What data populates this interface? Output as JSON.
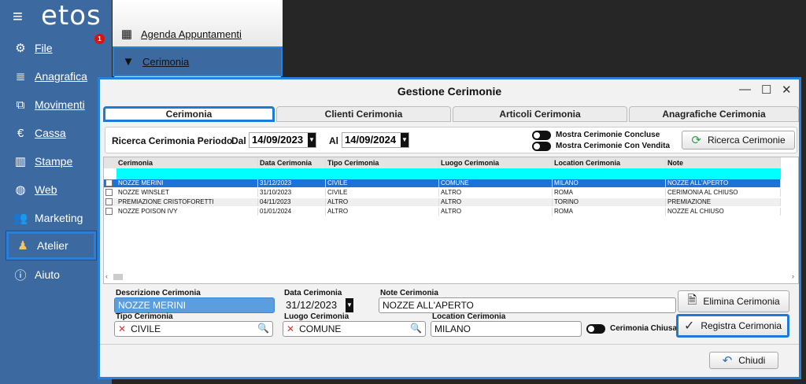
{
  "app": {
    "logo": "etos",
    "badge": "1"
  },
  "sidebar": {
    "items": [
      {
        "label": "File",
        "icon": "gear-icon"
      },
      {
        "label": "Anagrafica",
        "icon": "database-icon"
      },
      {
        "label": "Movimenti",
        "icon": "cubes-icon"
      },
      {
        "label": "Cassa",
        "icon": "euro-icon"
      },
      {
        "label": "Stampe",
        "icon": "bar-chart-icon"
      },
      {
        "label": "Web",
        "icon": "globe-icon"
      },
      {
        "label": "Marketing",
        "icon": "users-icon"
      },
      {
        "label": "Atelier",
        "icon": "child-icon"
      },
      {
        "label": "Aiuto",
        "icon": "info-icon"
      }
    ]
  },
  "submenu": {
    "items": [
      {
        "label": "Agenda Appuntamenti",
        "icon": "calendar-icon"
      },
      {
        "label": "Cerimonia",
        "icon": "tie-icon"
      }
    ]
  },
  "dialog": {
    "title": "Gestione Cerimonie",
    "tabs": [
      "Cerimonia",
      "Clienti Cerimonia",
      "Articoli Cerimonia",
      "Anagrafiche Cerimonia"
    ],
    "search": {
      "period_label": "Ricerca Cerimonia Periodo",
      "from_label": "Dal",
      "from_value": "14/09/2023",
      "to_label": "Al",
      "to_value": "14/09/2024",
      "toggle1": "Mostra Cerimonie Concluse",
      "toggle2": "Mostra Cerimonie Con Vendita",
      "search_button": "Ricerca Cerimonie"
    },
    "grid": {
      "columns": [
        "Cerimonia",
        "Data Cerimonia",
        "Tipo Cerimonia",
        "Luogo Cerimonia",
        "Location Cerimonia",
        "Note"
      ],
      "rows": [
        [
          "NOZZE MERINI",
          "31/12/2023",
          "CIVILE",
          "COMUNE",
          "MILANO",
          "NOZZE ALL'APERTO"
        ],
        [
          "NOZZE WINSLET",
          "31/10/2023",
          "CIVILE",
          "ALTRO",
          "ROMA",
          "CERIMONIA AL CHIUSO"
        ],
        [
          "PREMIAZIONE CRISTOFORETTI",
          "04/11/2023",
          "ALTRO",
          "ALTRO",
          "TORINO",
          "PREMIAZIONE"
        ],
        [
          "NOZZE POISON IVY",
          "01/01/2024",
          "ALTRO",
          "ALTRO",
          "ROMA",
          "NOZZE AL CHIUSO"
        ]
      ]
    },
    "form": {
      "desc_label": "Descrizione Cerimonia",
      "desc_value": "NOZZE MERINI",
      "date_label": "Data Cerimonia",
      "date_value": "31/12/2023",
      "note_label": "Note Cerimonia",
      "note_value": "NOZZE ALL'APERTO",
      "tipo_label": "Tipo Cerimonia",
      "tipo_value": "CIVILE",
      "luogo_label": "Luogo Cerimonia",
      "luogo_value": "COMUNE",
      "location_label": "Location Cerimonia",
      "location_value": "MILANO",
      "chiusa_label": "Cerimonia Chiusa",
      "delete_button": "Elimina Cerimonia",
      "save_button": "Registra Cerimonia"
    },
    "close_button": "Chiudi"
  }
}
